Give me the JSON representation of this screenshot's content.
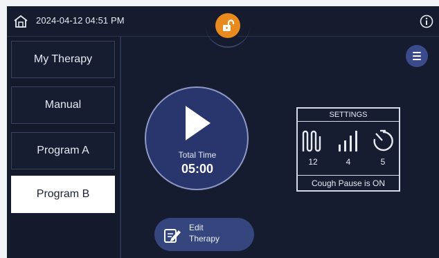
{
  "header": {
    "datetime": "2024-04-12  04:51 PM",
    "home_icon": "home-icon",
    "lock_icon": "unlock-icon",
    "info_icon": "info-icon"
  },
  "sidebar": {
    "items": [
      {
        "label": "My Therapy",
        "active": false
      },
      {
        "label": "Manual",
        "active": false
      },
      {
        "label": "Program A",
        "active": false
      },
      {
        "label": "Program B",
        "active": true
      }
    ]
  },
  "main": {
    "menu_icon": "hamburger-menu-icon",
    "play": {
      "total_label": "Total Time",
      "total_value": "05:00"
    },
    "settings": {
      "title": "SETTINGS",
      "items": [
        {
          "icon": "oscillation-wave-icon",
          "value": "12"
        },
        {
          "icon": "signal-bars-icon",
          "value": "4"
        },
        {
          "icon": "timer-icon",
          "value": "5"
        }
      ],
      "cough_pause": "Cough Pause is ON"
    },
    "edit": {
      "line1": "Edit",
      "line2": "Therapy"
    }
  },
  "colors": {
    "background": "#151c30",
    "accent_orange": "#e98a1e",
    "play_fill": "#28366d",
    "button_blue": "#35457e"
  }
}
